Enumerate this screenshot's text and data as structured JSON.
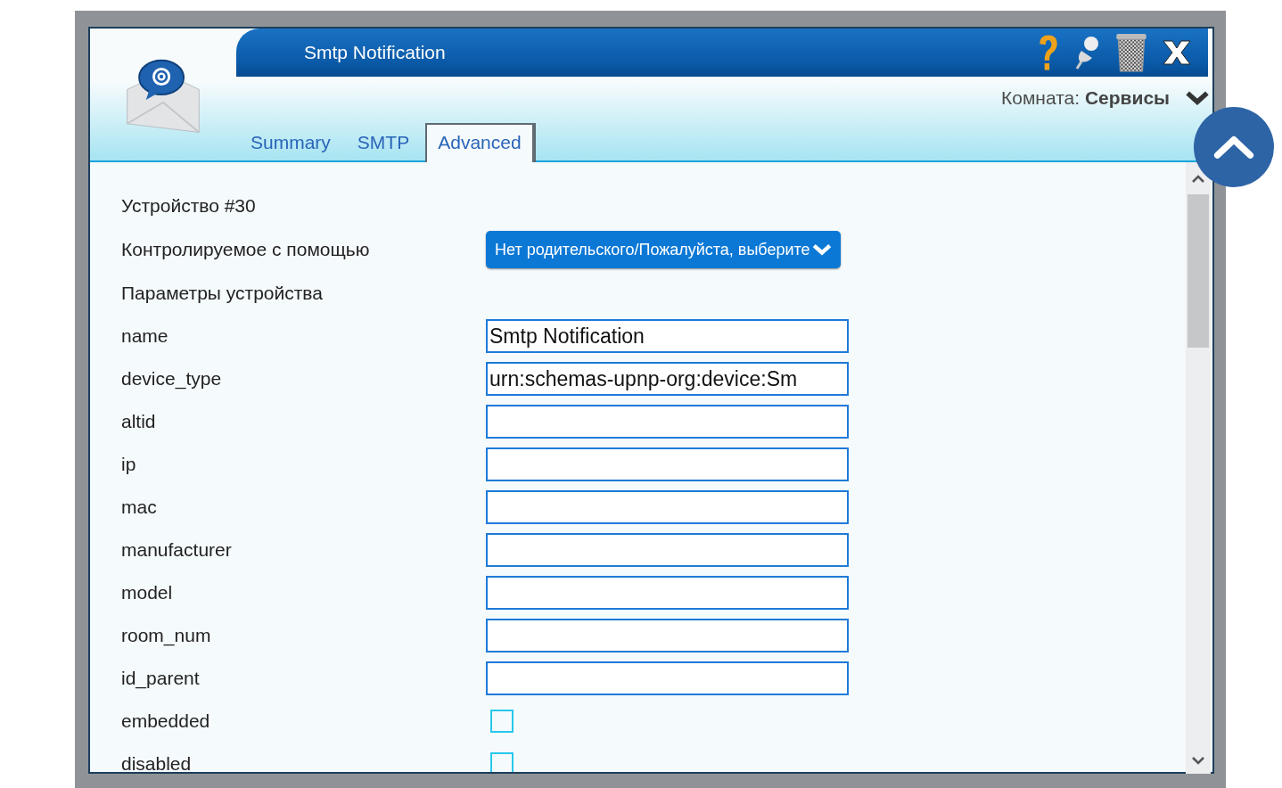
{
  "window": {
    "title": "Smtp Notification"
  },
  "room": {
    "label": "Комната:",
    "value": "Сервисы"
  },
  "tabs": [
    {
      "label": "Summary",
      "selected": false
    },
    {
      "label": "SMTP",
      "selected": false
    },
    {
      "label": "Advanced",
      "selected": true
    }
  ],
  "device_heading": "Устройство #30",
  "controlled_by": {
    "label": "Контролируемое с помощью",
    "value": "Нет родительского/Пожалуйста, выберите"
  },
  "params_heading": "Параметры устройства",
  "params": [
    {
      "label": "name",
      "kind": "text",
      "value": "Smtp Notification"
    },
    {
      "label": "device_type",
      "kind": "text",
      "value": "urn:schemas-upnp-org:device:Sm"
    },
    {
      "label": "altid",
      "kind": "text"
    },
    {
      "label": "ip",
      "kind": "text"
    },
    {
      "label": "mac",
      "kind": "text"
    },
    {
      "label": "manufacturer",
      "kind": "text"
    },
    {
      "label": "model",
      "kind": "text"
    },
    {
      "label": "room_num",
      "kind": "text"
    },
    {
      "label": "id_parent",
      "kind": "text"
    },
    {
      "label": "embedded",
      "kind": "checkbox",
      "checked": false
    },
    {
      "label": "disabled",
      "kind": "checkbox",
      "checked": false
    }
  ]
}
